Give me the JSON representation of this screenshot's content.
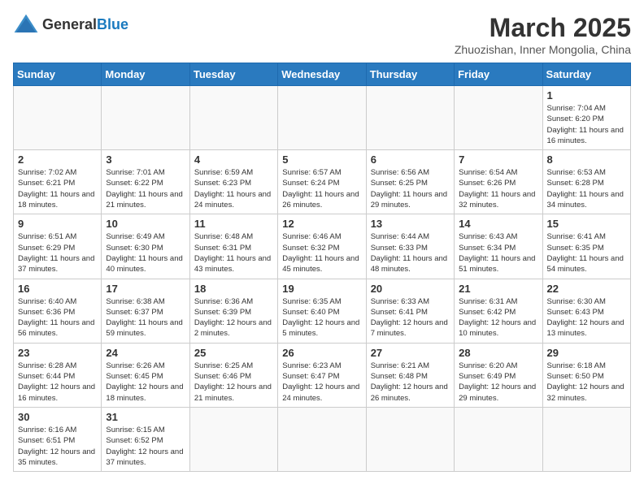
{
  "header": {
    "logo_general": "General",
    "logo_blue": "Blue",
    "title": "March 2025",
    "subtitle": "Zhuozishan, Inner Mongolia, China"
  },
  "weekdays": [
    "Sunday",
    "Monday",
    "Tuesday",
    "Wednesday",
    "Thursday",
    "Friday",
    "Saturday"
  ],
  "weeks": [
    [
      {
        "day": "",
        "info": ""
      },
      {
        "day": "",
        "info": ""
      },
      {
        "day": "",
        "info": ""
      },
      {
        "day": "",
        "info": ""
      },
      {
        "day": "",
        "info": ""
      },
      {
        "day": "",
        "info": ""
      },
      {
        "day": "1",
        "info": "Sunrise: 7:04 AM\nSunset: 6:20 PM\nDaylight: 11 hours and 16 minutes."
      }
    ],
    [
      {
        "day": "2",
        "info": "Sunrise: 7:02 AM\nSunset: 6:21 PM\nDaylight: 11 hours and 18 minutes."
      },
      {
        "day": "3",
        "info": "Sunrise: 7:01 AM\nSunset: 6:22 PM\nDaylight: 11 hours and 21 minutes."
      },
      {
        "day": "4",
        "info": "Sunrise: 6:59 AM\nSunset: 6:23 PM\nDaylight: 11 hours and 24 minutes."
      },
      {
        "day": "5",
        "info": "Sunrise: 6:57 AM\nSunset: 6:24 PM\nDaylight: 11 hours and 26 minutes."
      },
      {
        "day": "6",
        "info": "Sunrise: 6:56 AM\nSunset: 6:25 PM\nDaylight: 11 hours and 29 minutes."
      },
      {
        "day": "7",
        "info": "Sunrise: 6:54 AM\nSunset: 6:26 PM\nDaylight: 11 hours and 32 minutes."
      },
      {
        "day": "8",
        "info": "Sunrise: 6:53 AM\nSunset: 6:28 PM\nDaylight: 11 hours and 34 minutes."
      }
    ],
    [
      {
        "day": "9",
        "info": "Sunrise: 6:51 AM\nSunset: 6:29 PM\nDaylight: 11 hours and 37 minutes."
      },
      {
        "day": "10",
        "info": "Sunrise: 6:49 AM\nSunset: 6:30 PM\nDaylight: 11 hours and 40 minutes."
      },
      {
        "day": "11",
        "info": "Sunrise: 6:48 AM\nSunset: 6:31 PM\nDaylight: 11 hours and 43 minutes."
      },
      {
        "day": "12",
        "info": "Sunrise: 6:46 AM\nSunset: 6:32 PM\nDaylight: 11 hours and 45 minutes."
      },
      {
        "day": "13",
        "info": "Sunrise: 6:44 AM\nSunset: 6:33 PM\nDaylight: 11 hours and 48 minutes."
      },
      {
        "day": "14",
        "info": "Sunrise: 6:43 AM\nSunset: 6:34 PM\nDaylight: 11 hours and 51 minutes."
      },
      {
        "day": "15",
        "info": "Sunrise: 6:41 AM\nSunset: 6:35 PM\nDaylight: 11 hours and 54 minutes."
      }
    ],
    [
      {
        "day": "16",
        "info": "Sunrise: 6:40 AM\nSunset: 6:36 PM\nDaylight: 11 hours and 56 minutes."
      },
      {
        "day": "17",
        "info": "Sunrise: 6:38 AM\nSunset: 6:37 PM\nDaylight: 11 hours and 59 minutes."
      },
      {
        "day": "18",
        "info": "Sunrise: 6:36 AM\nSunset: 6:39 PM\nDaylight: 12 hours and 2 minutes."
      },
      {
        "day": "19",
        "info": "Sunrise: 6:35 AM\nSunset: 6:40 PM\nDaylight: 12 hours and 5 minutes."
      },
      {
        "day": "20",
        "info": "Sunrise: 6:33 AM\nSunset: 6:41 PM\nDaylight: 12 hours and 7 minutes."
      },
      {
        "day": "21",
        "info": "Sunrise: 6:31 AM\nSunset: 6:42 PM\nDaylight: 12 hours and 10 minutes."
      },
      {
        "day": "22",
        "info": "Sunrise: 6:30 AM\nSunset: 6:43 PM\nDaylight: 12 hours and 13 minutes."
      }
    ],
    [
      {
        "day": "23",
        "info": "Sunrise: 6:28 AM\nSunset: 6:44 PM\nDaylight: 12 hours and 16 minutes."
      },
      {
        "day": "24",
        "info": "Sunrise: 6:26 AM\nSunset: 6:45 PM\nDaylight: 12 hours and 18 minutes."
      },
      {
        "day": "25",
        "info": "Sunrise: 6:25 AM\nSunset: 6:46 PM\nDaylight: 12 hours and 21 minutes."
      },
      {
        "day": "26",
        "info": "Sunrise: 6:23 AM\nSunset: 6:47 PM\nDaylight: 12 hours and 24 minutes."
      },
      {
        "day": "27",
        "info": "Sunrise: 6:21 AM\nSunset: 6:48 PM\nDaylight: 12 hours and 26 minutes."
      },
      {
        "day": "28",
        "info": "Sunrise: 6:20 AM\nSunset: 6:49 PM\nDaylight: 12 hours and 29 minutes."
      },
      {
        "day": "29",
        "info": "Sunrise: 6:18 AM\nSunset: 6:50 PM\nDaylight: 12 hours and 32 minutes."
      }
    ],
    [
      {
        "day": "30",
        "info": "Sunrise: 6:16 AM\nSunset: 6:51 PM\nDaylight: 12 hours and 35 minutes."
      },
      {
        "day": "31",
        "info": "Sunrise: 6:15 AM\nSunset: 6:52 PM\nDaylight: 12 hours and 37 minutes."
      },
      {
        "day": "",
        "info": ""
      },
      {
        "day": "",
        "info": ""
      },
      {
        "day": "",
        "info": ""
      },
      {
        "day": "",
        "info": ""
      },
      {
        "day": "",
        "info": ""
      }
    ]
  ]
}
